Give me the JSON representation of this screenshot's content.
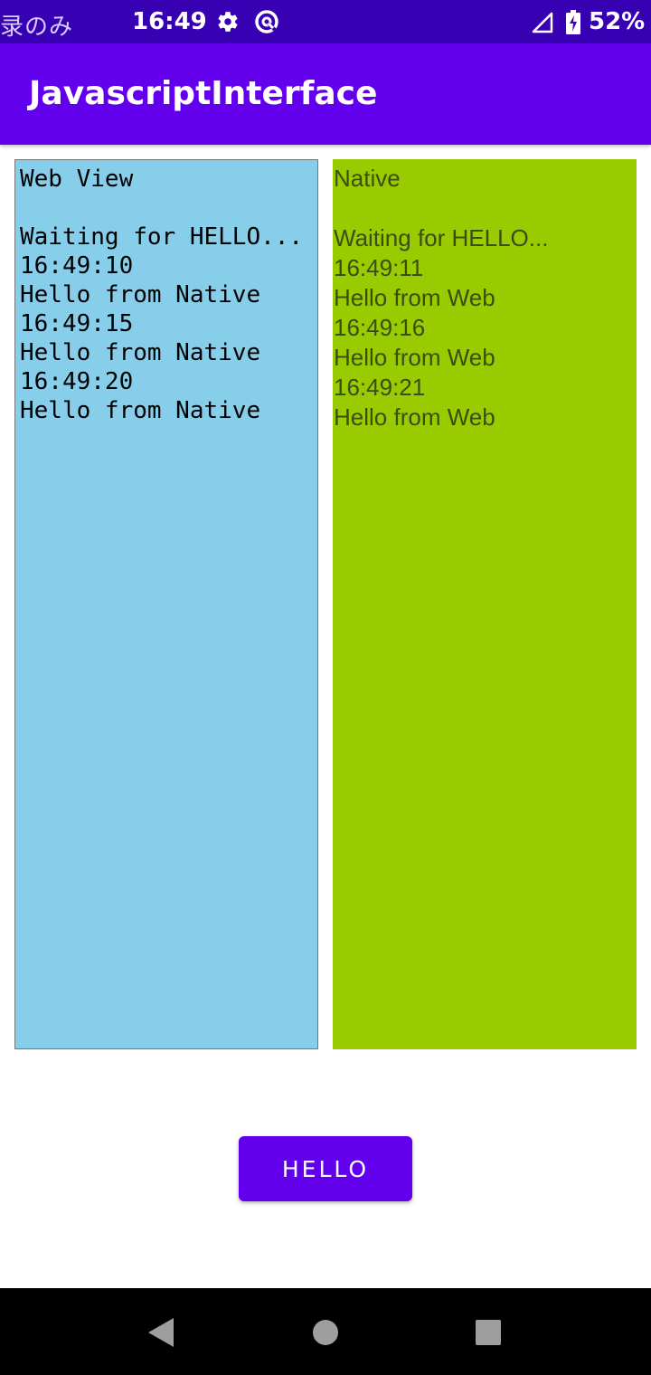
{
  "status_bar": {
    "left_text": "录のみ",
    "time": "16:49",
    "battery_percent": "52%",
    "icons": [
      "settings-gear-icon",
      "data-saver-icon",
      "signal-icon",
      "battery-charging-icon"
    ]
  },
  "app_bar": {
    "title": "JavascriptInterface",
    "color": "#6200ee"
  },
  "web_view": {
    "heading": "Web View",
    "status": "Waiting for HELLO...",
    "log": [
      {
        "time": "16:49:10",
        "message": "Hello from Native"
      },
      {
        "time": "16:49:15",
        "message": "Hello from Native"
      },
      {
        "time": "16:49:20",
        "message": "Hello from Native"
      }
    ],
    "background": "#87ceeb"
  },
  "native": {
    "heading": "Native",
    "status": "Waiting for HELLO...",
    "log": [
      {
        "time": "16:49:11",
        "message": "Hello from Web"
      },
      {
        "time": "16:49:16",
        "message": "Hello from Web"
      },
      {
        "time": "16:49:21",
        "message": "Hello from Web"
      }
    ],
    "background": "#99cc00"
  },
  "hello_button": {
    "label": "HELLO"
  },
  "nav_bar": {
    "icons": [
      "back-icon",
      "home-icon",
      "recents-icon"
    ]
  }
}
